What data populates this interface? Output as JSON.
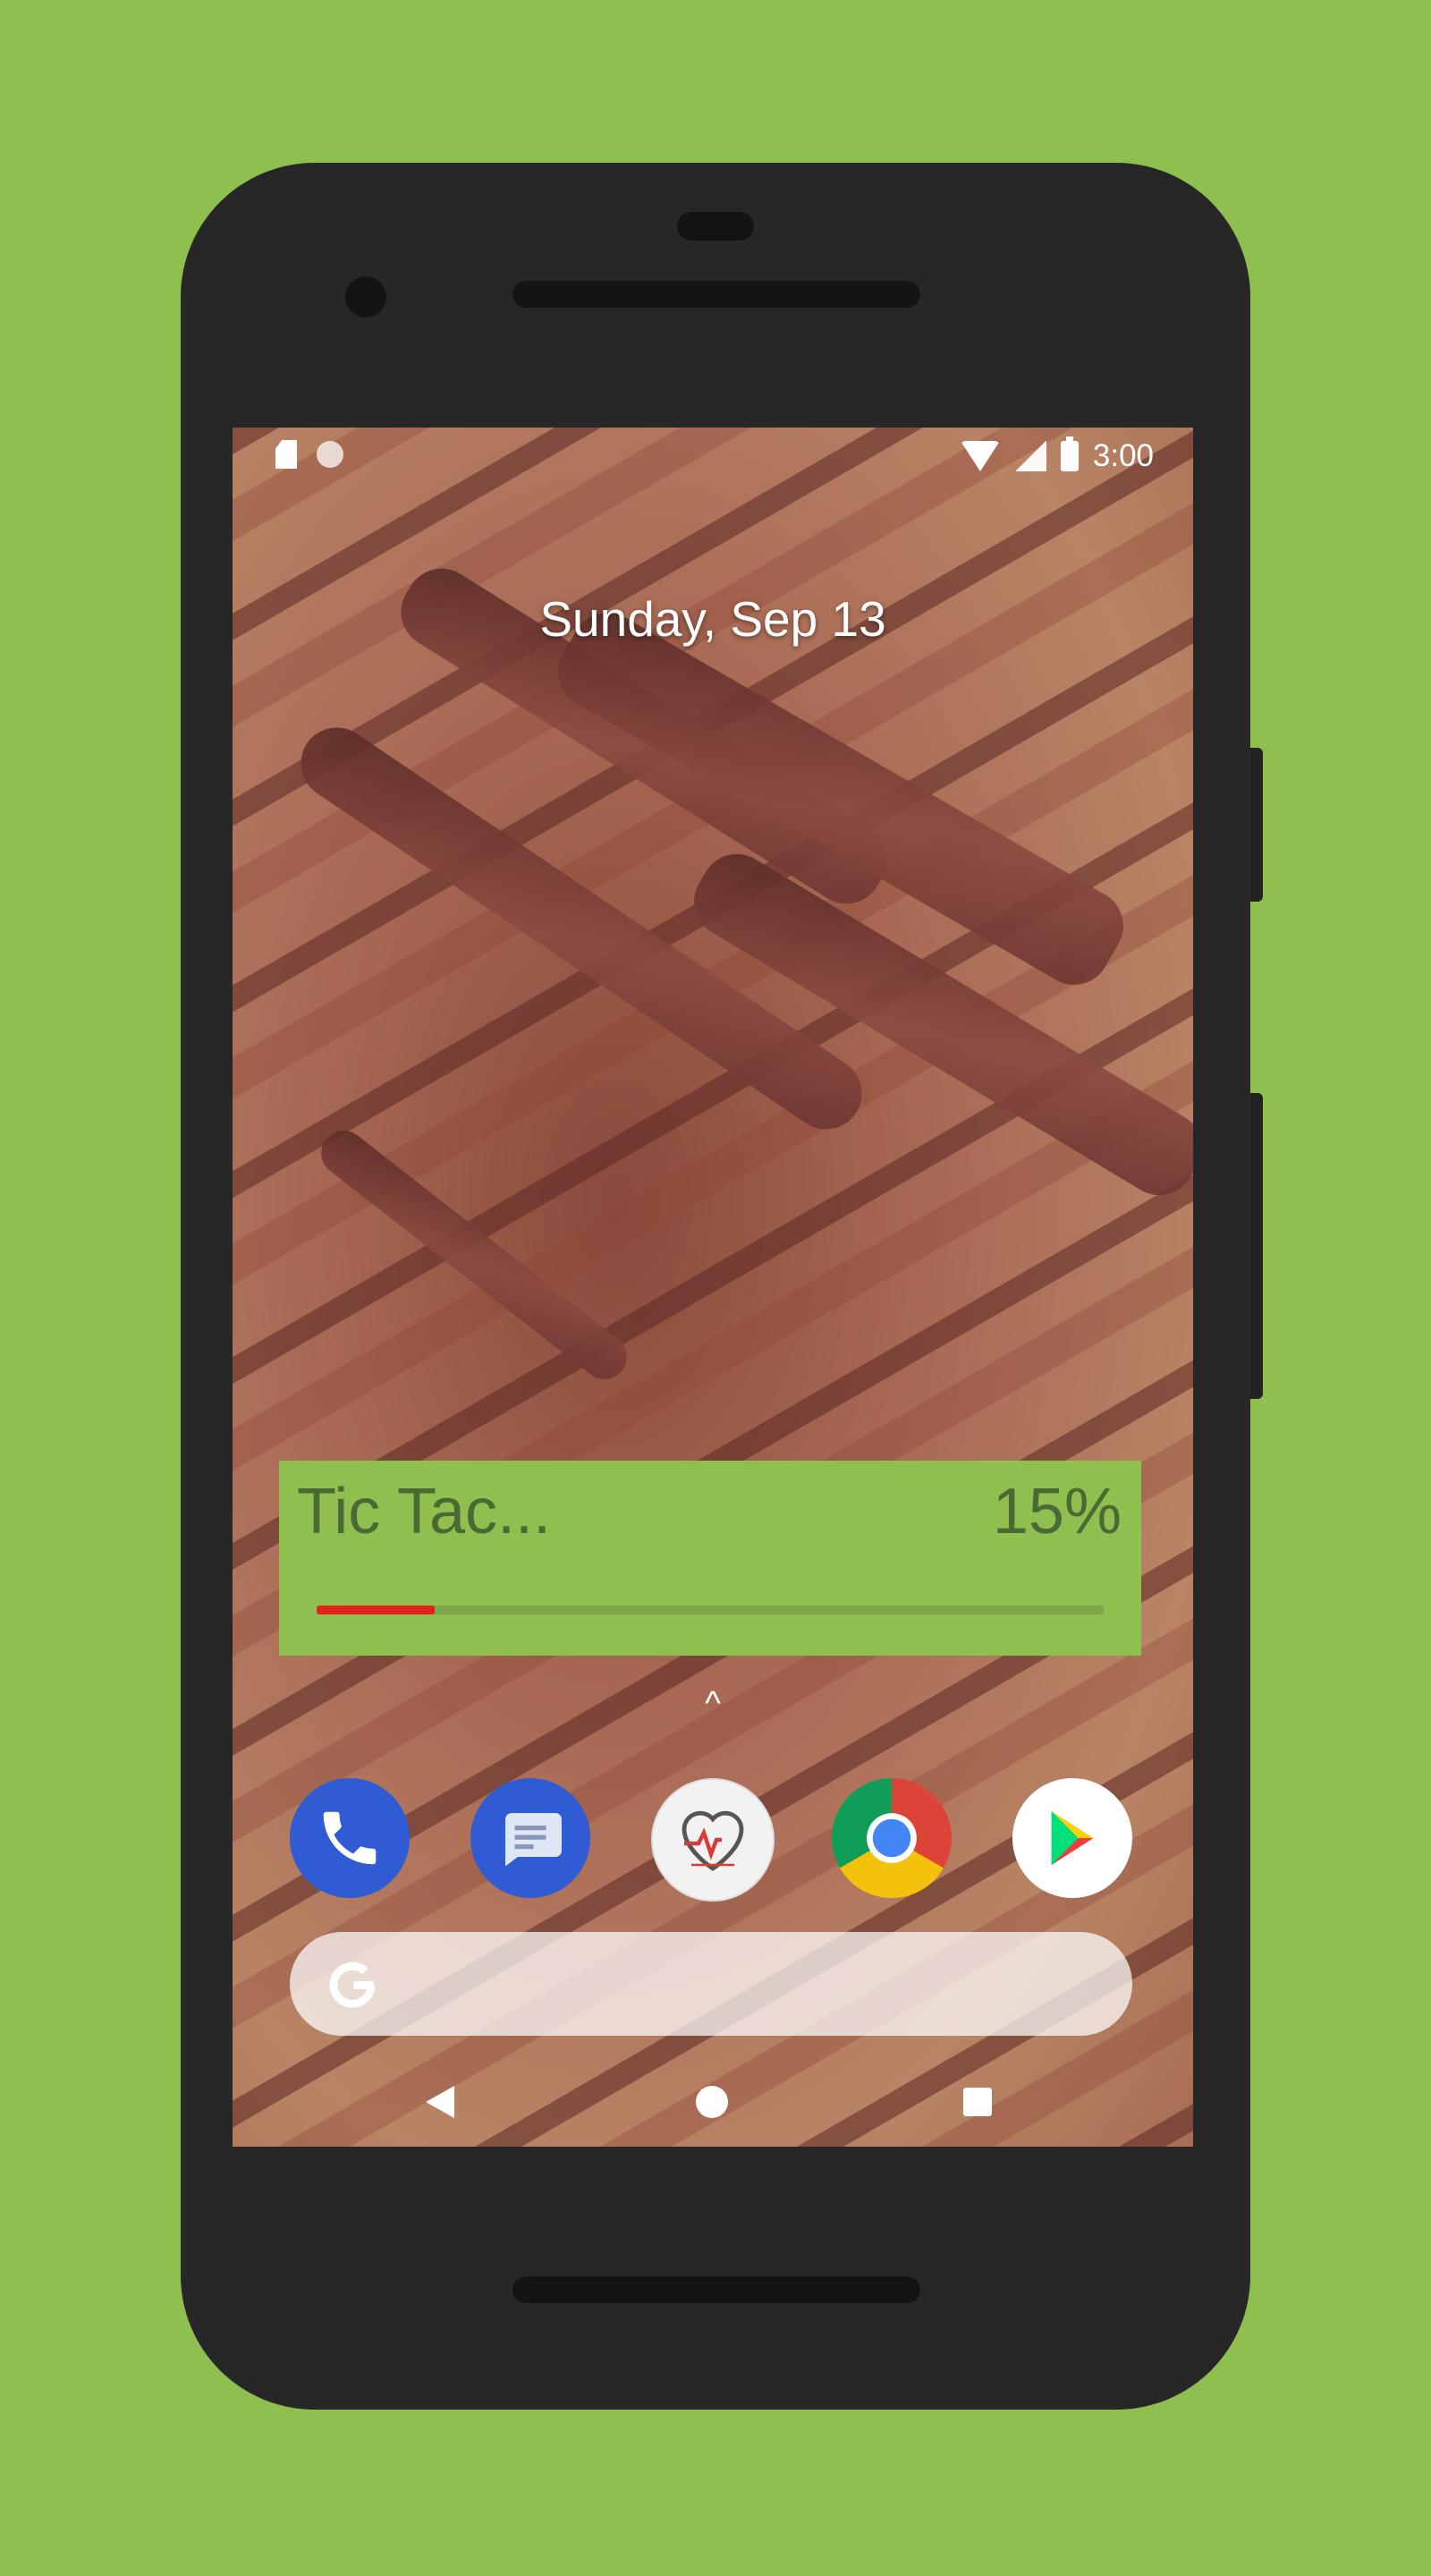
{
  "status_bar": {
    "time": "3:00",
    "left_icons": [
      "sd-card-icon",
      "moon-icon"
    ],
    "right_icons": [
      "wifi-icon",
      "signal-icon",
      "battery-icon"
    ]
  },
  "home": {
    "date": "Sunday, Sep 13"
  },
  "widget": {
    "title": "Tic Tac...",
    "percent": "15%",
    "progress": 0.15,
    "colors": {
      "background": "#8fbf4f",
      "text": "#4a6a33",
      "progress_fill": "#e0231a"
    }
  },
  "dock": {
    "apps": [
      "phone-app-icon",
      "messages-app-icon",
      "heart-monitor-app-icon",
      "chrome-app-icon",
      "play-store-app-icon"
    ]
  },
  "search": {
    "logo": "G"
  },
  "navigation": {
    "buttons": [
      "back",
      "home",
      "recents"
    ]
  },
  "colors": {
    "page_background": "#8fbf4f",
    "phone_body": "#272727"
  }
}
